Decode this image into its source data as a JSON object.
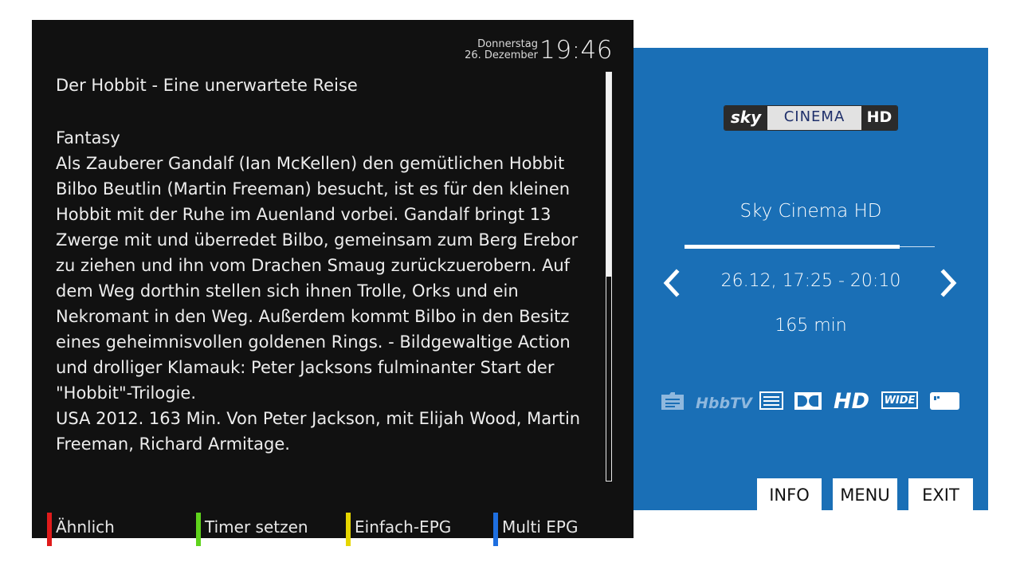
{
  "epg": {
    "day": "Donnerstag",
    "date": "26. Dezember",
    "time": "19:46",
    "title": "Der Hobbit - Eine unerwartete Reise",
    "genre": "Fantasy",
    "description": "Als Zauberer Gandalf (Ian McKellen) den gemütlichen Hobbit Bilbo Beutlin (Martin Freeman) besucht, ist es für den kleinen Hobbit mit der Ruhe im Auenland vorbei. Gandalf bringt 13 Zwerge mit und überredet Bilbo, gemeinsam zum Berg Erebor zu ziehen und ihn vom Drachen Smaug zurückzuerobern. Auf dem Weg dorthin stellen sich ihnen Trolle, Orks und ein Nekromant in den Weg. Außerdem kommt Bilbo in den Besitz eines geheimnisvollen goldenen Rings. - Bildgewaltige Action und drolliger Klamauk: Peter Jacksons fulminanter Start der \"Hobbit\"-Trilogie.",
    "credits": "USA 2012. 163 Min. Von Peter Jackson, mit Elijah Wood, Martin Freeman, Richard Armitage.",
    "scroll_fraction": 0.5
  },
  "function_keys": [
    {
      "label": "Ähnlich",
      "color": "#e01b1b"
    },
    {
      "label": "Timer setzen",
      "color": "#5fd31c"
    },
    {
      "label": "Einfach-EPG",
      "color": "#e6d600"
    },
    {
      "label": "Multi EPG",
      "color": "#1e6fe0"
    }
  ],
  "info": {
    "logo": {
      "sky": "sky",
      "cinema": "CINEMA",
      "hd": "HD"
    },
    "channel_name": "Sky Cinema HD",
    "progress": 0.86,
    "time_range": "26.12, 17:25 - 20:10",
    "duration": "165 min",
    "icons": [
      "subtitle-icon",
      "hbbtv-icon",
      "teletext-icon",
      "dolby-icon",
      "hd-icon",
      "widescreen-icon",
      "info-card-icon"
    ],
    "hbbtv_text": "HbbTV",
    "hd_text": "HD",
    "wide_text": "WIDE",
    "buttons": {
      "info": "INFO",
      "menu": "MENU",
      "exit": "EXIT"
    }
  },
  "colors": {
    "panel_bg": "#111111",
    "info_bg": "#1a6fb6"
  }
}
